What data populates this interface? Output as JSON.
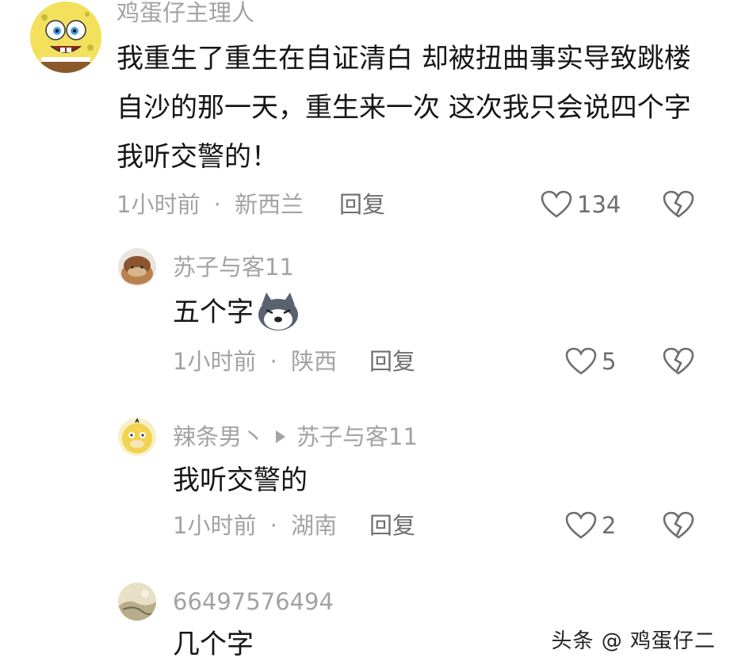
{
  "comments": [
    {
      "username": "鸡蛋仔主理人",
      "content": "我重生了重生在自证清白 却被扭曲事实导致跳楼自沙的那一天，重生来一次 这次我只会说四个字 我听交警的！",
      "time": "1小时前",
      "location": "新西兰",
      "reply_label": "回复",
      "likes": "134",
      "avatar_icon": "spongebob-avatar"
    },
    {
      "username": "苏子与客11",
      "content": "五个字",
      "content_emoji": "husky-emoji",
      "time": "1小时前",
      "location": "陕西",
      "reply_label": "回复",
      "likes": "5",
      "avatar_icon": "cat-avatar"
    },
    {
      "username": "辣条男丶",
      "reply_to": "苏子与客11",
      "content": "我听交警的",
      "time": "1小时前",
      "location": "湖南",
      "reply_label": "回复",
      "likes": "2",
      "avatar_icon": "psyduck-avatar"
    },
    {
      "username": "66497576494",
      "content": "几个字",
      "avatar_icon": "landscape-avatar"
    }
  ],
  "meta_separator": "·",
  "watermark": "头条 @ 鸡蛋仔二",
  "colors": {
    "meta_text": "#a3a3a3",
    "content_text": "#161616",
    "action_text": "#6e6e6e"
  }
}
